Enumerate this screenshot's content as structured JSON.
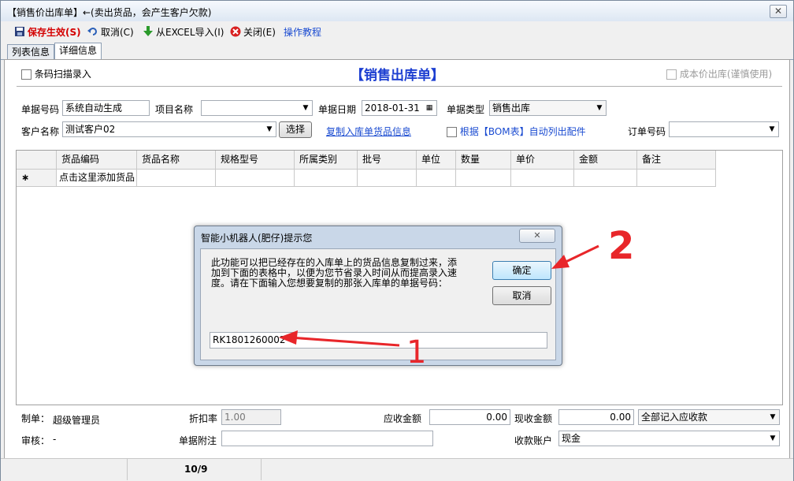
{
  "window": {
    "title": "【销售价出库单】←(卖出货品，会产生客户欠款)",
    "close_glyph": "✕"
  },
  "toolbar": {
    "save": "保存生效(S)",
    "cancel": "取消(C)",
    "import_excel": "从EXCEL导入(I)",
    "close": "关闭(E)",
    "tutorial": "操作教程"
  },
  "tabs": [
    "列表信息",
    "详细信息"
  ],
  "form": {
    "barcode_scan": "条码扫描录入",
    "heading": "【销售出库单】",
    "cost_price_out": "成本价出库(谨慎使用)",
    "doc_no_label": "单据号码",
    "doc_no_value": "系统自动生成",
    "project_label": "项目名称",
    "project_value": "",
    "date_label": "单据日期",
    "date_value": "2018-01-31",
    "type_label": "单据类型",
    "type_value": "销售出库",
    "customer_label": "客户名称",
    "customer_value": "测试客户02",
    "select_button": "选择",
    "copy_link": "复制入库单货品信息",
    "bom_option": "根据【BOM表】自动列出配件",
    "order_no_label": "订单号码",
    "order_no_value": ""
  },
  "grid": {
    "columns": [
      "货品编码",
      "货品名称",
      "规格型号",
      "所属类别",
      "批号",
      "单位",
      "数量",
      "单价",
      "金额",
      "备注"
    ],
    "new_row_marker": "∗",
    "new_row_hint": "点击这里添加货品"
  },
  "dialog": {
    "title": "智能小机器人(肥仔)提示您",
    "message": "此功能可以把已经存在的入库单上的货品信息复制过来，添加到下面的表格中，以便为您节省录入时间从而提高录入速度。请在下面输入您想要复制的那张入库单的单据号码：",
    "input_value": "RK1801260002",
    "ok_button": "确定",
    "cancel_button": "取消",
    "close_glyph": "✕",
    "annotation_1": "1",
    "annotation_2": "2"
  },
  "footer": {
    "maker_label": "制单：",
    "maker_value": "超级管理员",
    "discount_label": "折扣率",
    "discount_value": "1.00",
    "receivable_label": "应收金额",
    "receivable_value": "0.00",
    "cash_label": "现收金额",
    "cash_value": "0.00",
    "receivable_mode": "全部记入应收款",
    "auditor_label": "审核：",
    "auditor_value": "-",
    "note_label": "单据附注",
    "note_value": "",
    "account_label": "收款账户",
    "account_value": "现金"
  },
  "status": {
    "page": "10/9"
  },
  "colors": {
    "save_red": "#d40000",
    "heading_blue": "#1d3fd1",
    "arrow_red": "#e8262a"
  }
}
